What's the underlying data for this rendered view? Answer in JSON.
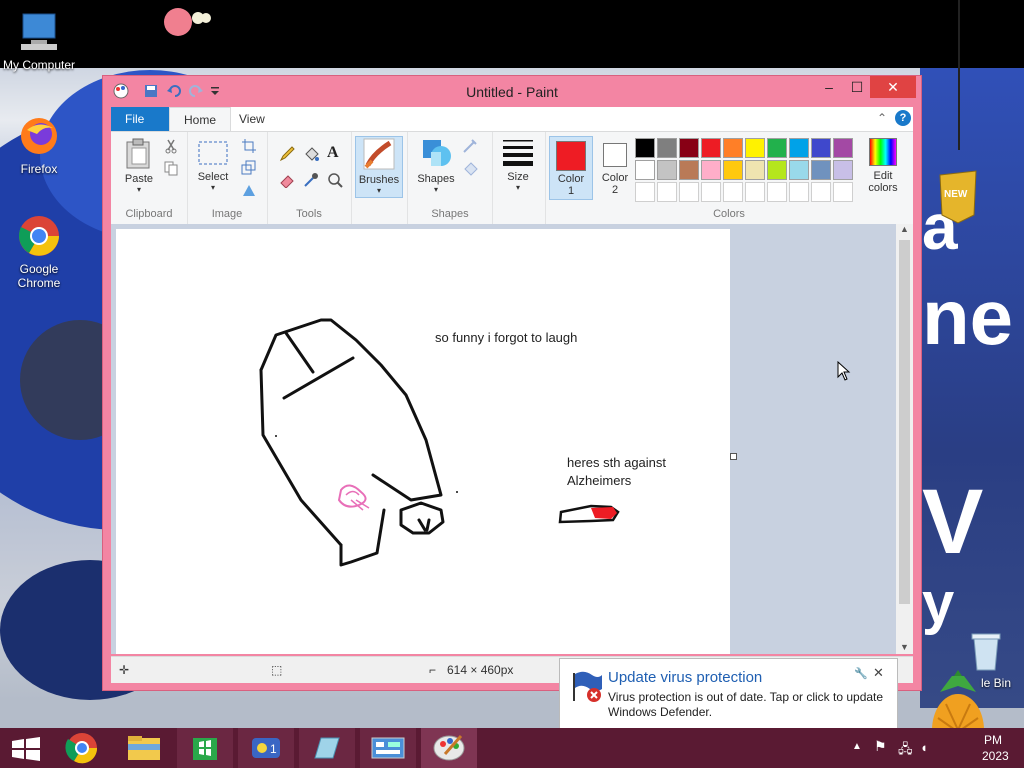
{
  "desktop": {
    "icons": [
      {
        "label": "My Computer"
      },
      {
        "label": "Firefox"
      },
      {
        "label": "Google Chrome"
      },
      {
        "label": "le Bin"
      }
    ],
    "bg_text": {
      "a": "a",
      "ne": "ne",
      "v": "V",
      "y": "y"
    },
    "badge": "NEW"
  },
  "window": {
    "title": "Untitled - Paint",
    "tabs": [
      "File",
      "Home",
      "View"
    ],
    "ribbon": {
      "clipboard": {
        "paste": "Paste",
        "group": "Clipboard"
      },
      "image": {
        "select": "Select",
        "group": "Image"
      },
      "tools": {
        "group": "Tools"
      },
      "brushes": {
        "label": "Brushes"
      },
      "shapes": {
        "label": "Shapes",
        "group": "Shapes"
      },
      "size": {
        "label": "Size"
      },
      "colors": {
        "color1": "Color\n1",
        "color1_line1": "Color",
        "color1_line2": "1",
        "color2_line1": "Color",
        "color2_line2": "2",
        "edit_line1": "Edit",
        "edit_line2": "colors",
        "group": "Colors",
        "color1_value": "#ee1c24",
        "color2_value": "#ffffff",
        "palette_row1": [
          "#000000",
          "#7f7f7f",
          "#880015",
          "#ed1c24",
          "#ff7f27",
          "#fff200",
          "#22b14c",
          "#00a2e8",
          "#3f48cc",
          "#a349a4"
        ],
        "palette_row2": [
          "#ffffff",
          "#c3c3c3",
          "#b97a57",
          "#ffaec9",
          "#ffc90e",
          "#efe4b0",
          "#b5e61d",
          "#99d9ea",
          "#7092be",
          "#c8bfe7"
        ],
        "palette_row3": [
          "#ffffff",
          "#ffffff",
          "#ffffff",
          "#ffffff",
          "#ffffff",
          "#ffffff",
          "#ffffff",
          "#ffffff",
          "#ffffff",
          "#ffffff"
        ]
      }
    },
    "canvas": {
      "text1": "so funny i forgot to laugh",
      "text2_line1": "heres sth against",
      "text2_line2": "Alzheimers"
    },
    "status": {
      "size": "614 × 460px"
    }
  },
  "notification": {
    "title": "Update virus protection",
    "body": "Virus protection is out of date. Tap or click to update Windows Defender."
  },
  "taskbar": {
    "clock_line1": "PM",
    "clock_line2": "2023"
  }
}
